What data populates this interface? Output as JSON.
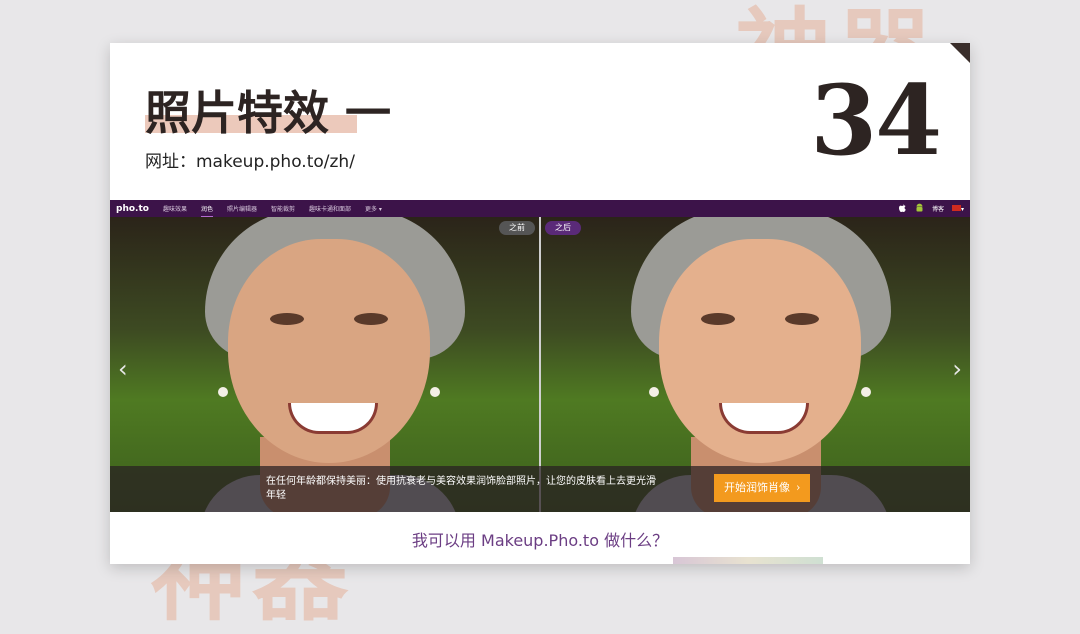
{
  "background": {
    "top_text": "神器",
    "bottom_text": "神器"
  },
  "slide": {
    "title": "照片特效 一",
    "subtitle": "网址：makeup.pho.to/zh/",
    "number": "34"
  },
  "site": {
    "logo": "pho.to",
    "nav": [
      {
        "label": "趣味效果"
      },
      {
        "label": "润色",
        "active": true
      },
      {
        "label": "照片编辑器"
      },
      {
        "label": "智能裁剪"
      },
      {
        "label": "趣味卡通和面部"
      },
      {
        "label": "更多 ▾"
      }
    ],
    "nav_right": {
      "apple": "",
      "android": "",
      "login": "博客",
      "lang": "▾"
    },
    "badges": {
      "before": "之前",
      "after": "之后"
    },
    "arrows": {
      "prev": "‹",
      "next": "›"
    },
    "caption": "在任何年龄都保持美丽：使用抗衰老与美容效果润饰脸部照片，让您的皮肤看上去更光滑年轻",
    "cta": {
      "label": "开始润饰肖像",
      "chevron": "›"
    },
    "question": "我可以用 Makeup.Pho.to 做什么？"
  },
  "colors": {
    "nav_bg": "#3c1349",
    "cta": "#f39a1e",
    "accent": "#6b3d83",
    "highlight": "#ecc9bb"
  }
}
